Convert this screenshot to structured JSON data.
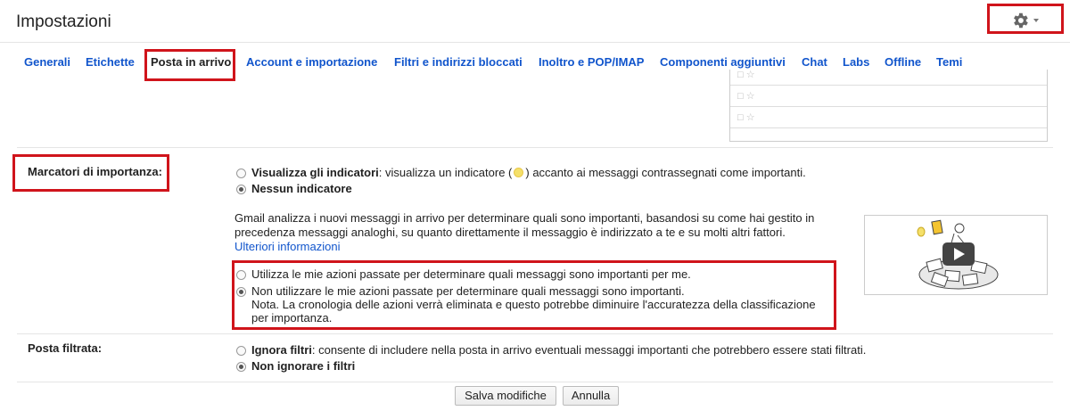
{
  "header": {
    "title": "Impostazioni",
    "gear_icon": "gear-icon"
  },
  "tabs": [
    {
      "label": "Generali",
      "active": false
    },
    {
      "label": "Etichette",
      "active": false
    },
    {
      "label": "Posta in arrivo",
      "active": true
    },
    {
      "label": "Account e importazione",
      "active": false
    },
    {
      "label": "Filtri e indirizzi bloccati",
      "active": false
    },
    {
      "label": "Inoltro e POP/IMAP",
      "active": false
    },
    {
      "label": "Componenti aggiuntivi",
      "active": false
    },
    {
      "label": "Chat",
      "active": false
    },
    {
      "label": "Labs",
      "active": false
    },
    {
      "label": "Offline",
      "active": false
    },
    {
      "label": "Temi",
      "active": false
    }
  ],
  "importance": {
    "label": "Marcatori di importanza:",
    "show_indicators_bold": "Visualizza gli indicatori",
    "show_indicators_rest_a": ": visualizza un indicatore (",
    "show_indicators_rest_b": ") accanto ai messaggi contrassegnati come importanti.",
    "no_indicator": "Nessun indicatore",
    "selected": "no_indicator",
    "description": "Gmail analizza i nuovi messaggi in arrivo per determinare quali sono importanti, basandosi su come hai gestito in precedenza messaggi analoghi, su quanto direttamente il messaggio è indirizzato a te e su molti altri fattori.",
    "learn_more": "Ulteriori informazioni",
    "use_past_actions": "Utilizza le mie azioni passate per determinare quali messaggi sono importanti per me.",
    "dont_use_past_actions": "Non utilizzare le mie azioni passate per determinare quali messaggi sono importanti.",
    "note": "Nota. La cronologia delle azioni verrà eliminata e questo potrebbe diminuire l'accuratezza della classificazione per importanza.",
    "past_actions_selected": "dont_use"
  },
  "filtered": {
    "label": "Posta filtrata:",
    "ignore_bold": "Ignora filtri",
    "ignore_rest": ": consente di includere nella posta in arrivo eventuali messaggi importanti che potrebbero essere stati filtrati.",
    "dont_ignore": "Non ignorare i filtri",
    "selected": "dont_ignore"
  },
  "buttons": {
    "save": "Salva modifiche",
    "cancel": "Annulla"
  },
  "colors": {
    "link": "#1155cc",
    "highlight": "#d0141b"
  }
}
